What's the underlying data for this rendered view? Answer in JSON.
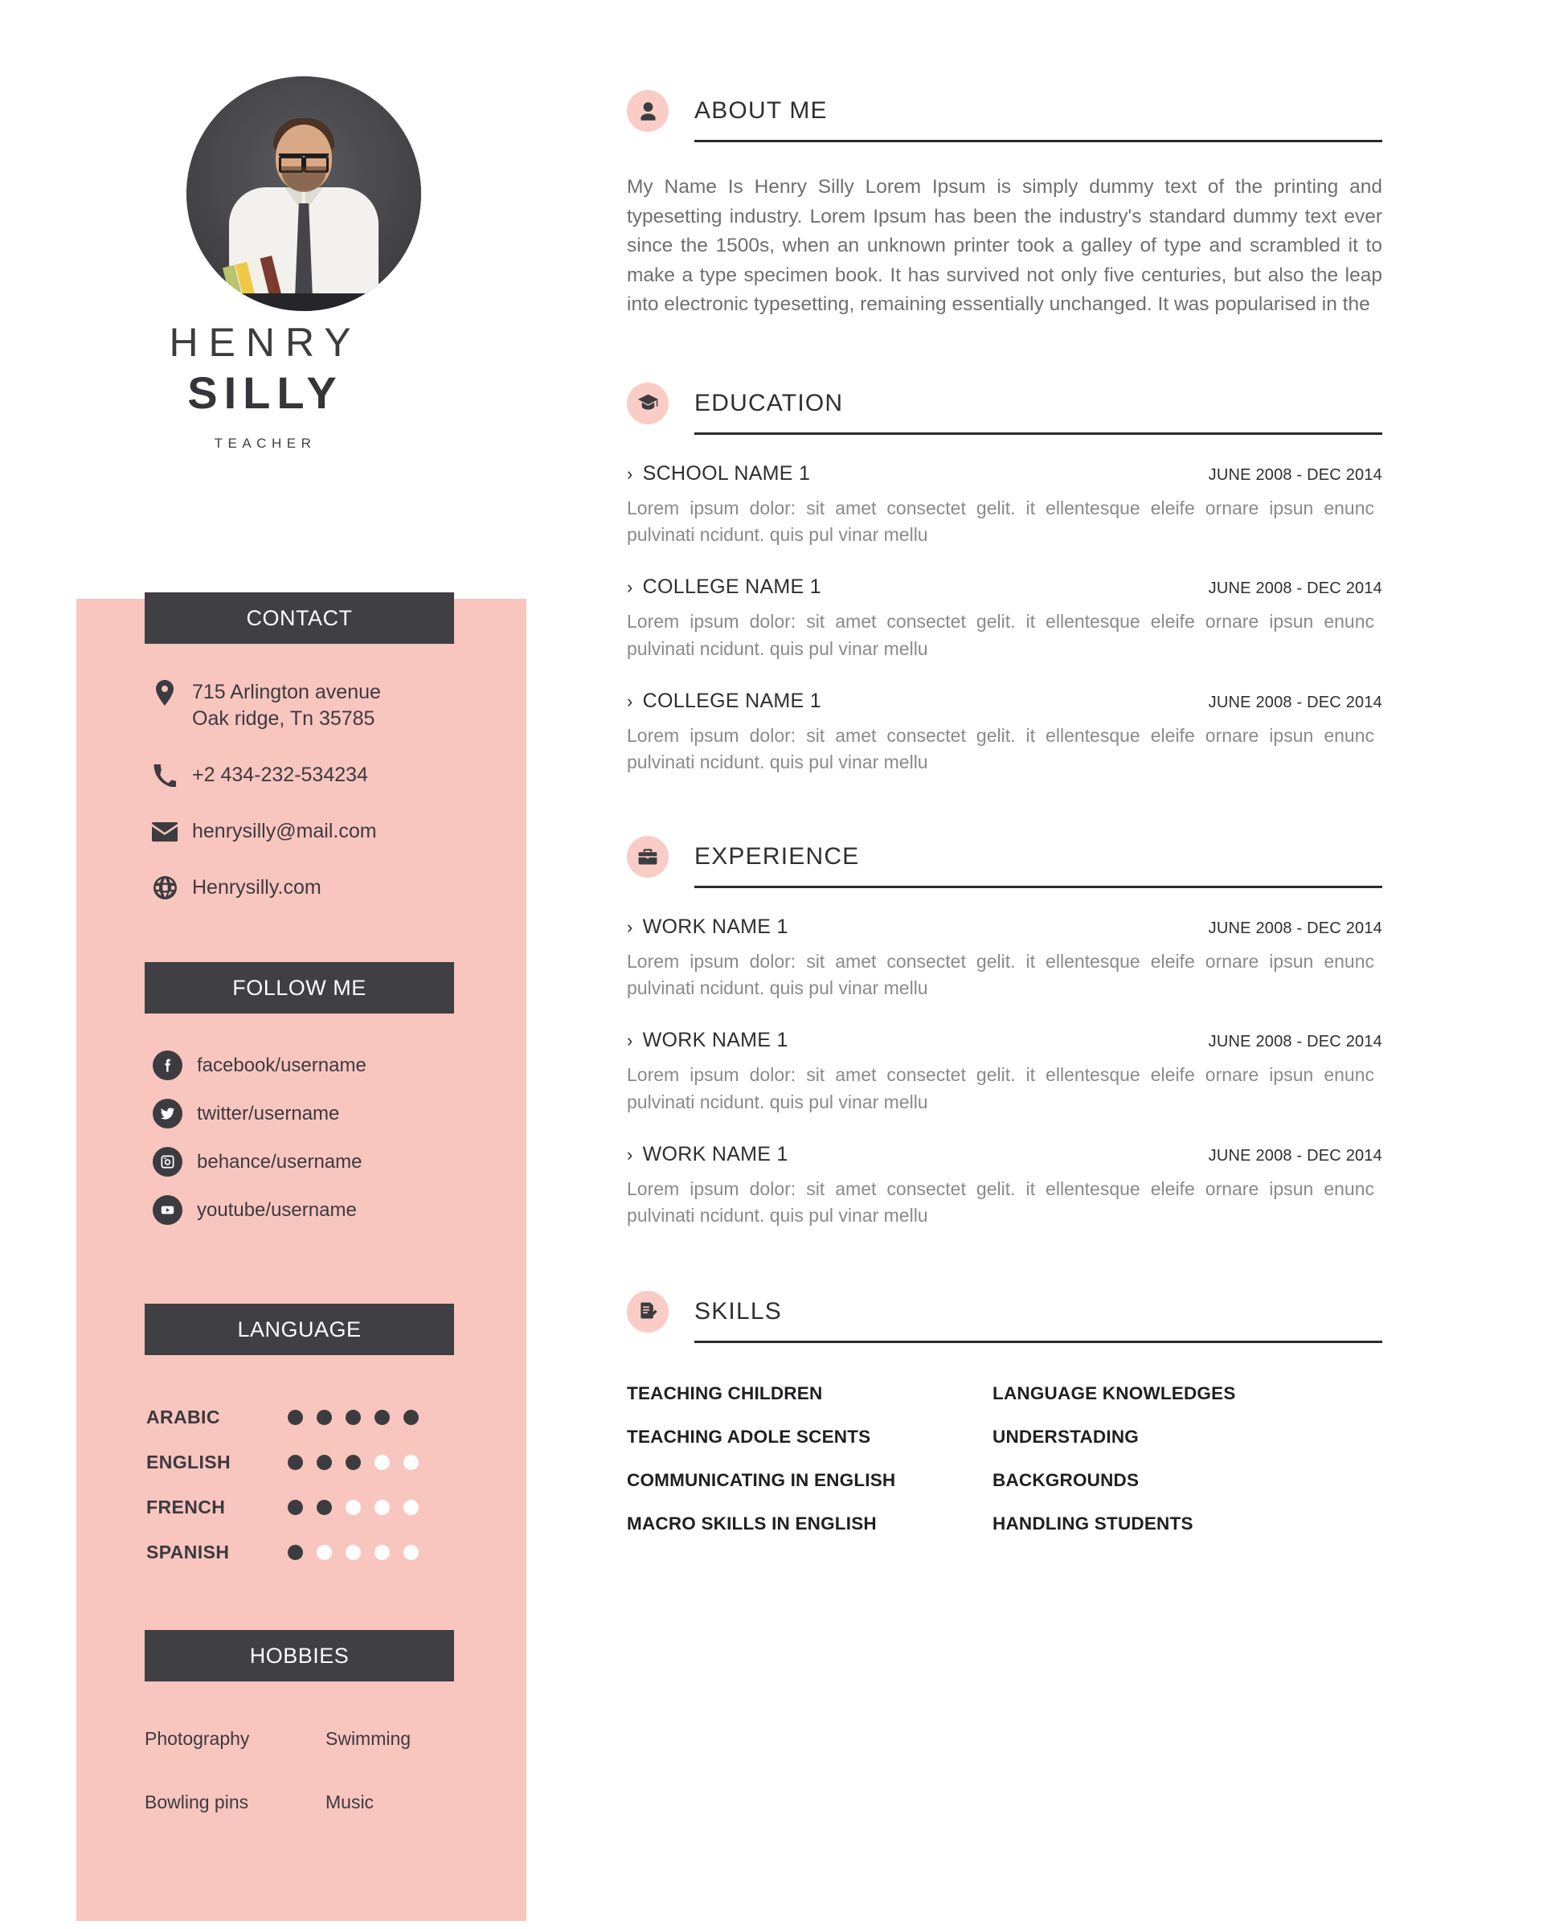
{
  "profile": {
    "first_name": "HENRY",
    "last_name": "SILLY",
    "role": "TEACHER",
    "photo_alt": "portrait-photo"
  },
  "sidebar": {
    "contact": {
      "title": "CONTACT",
      "items": [
        {
          "icon": "location-icon",
          "text": "715 Arlington avenue\nOak ridge, Tn 35785"
        },
        {
          "icon": "phone-icon",
          "text": "+2 434-232-534234"
        },
        {
          "icon": "email-icon",
          "text": "henrysilly@mail.com"
        },
        {
          "icon": "globe-icon",
          "text": "Henrysilly.com"
        }
      ]
    },
    "follow": {
      "title": "FOLLOW ME",
      "items": [
        {
          "icon": "facebook-icon",
          "text": "facebook/username"
        },
        {
          "icon": "twitter-icon",
          "text": "twitter/username"
        },
        {
          "icon": "instagram-icon",
          "text": "behance/username"
        },
        {
          "icon": "youtube-icon",
          "text": "youtube/username"
        }
      ]
    },
    "language": {
      "title": "LANGUAGE",
      "max_level": 5,
      "items": [
        {
          "name": "ARABIC",
          "level": 5
        },
        {
          "name": "ENGLISH",
          "level": 3
        },
        {
          "name": "FRENCH",
          "level": 2
        },
        {
          "name": "SPANISH",
          "level": 1
        }
      ]
    },
    "hobbies": {
      "title": "HOBBIES",
      "items": [
        "Photography",
        "Swimming",
        "Bowling pins",
        "Music"
      ]
    }
  },
  "main": {
    "about": {
      "icon": "person-icon",
      "title": "ABOUT ME",
      "text": "My Name Is Henry Silly Lorem Ipsum is simply dummy text of the printing and typesetting industry. Lorem Ipsum has been the industry's standard dummy text ever since the 1500s, when an unknown printer took a galley of type and scrambled it to make a type specimen book. It has survived not only five centuries, but also the leap into electronic typesetting, remaining essentially unchanged. It was popularised in the"
    },
    "education": {
      "icon": "graduation-cap-icon",
      "title": "EDUCATION",
      "entries": [
        {
          "name": "SCHOOL NAME 1",
          "date": "JUNE 2008 - DEC 2014",
          "desc": "Lorem ipsum dolor: sit amet consectet gelit. it ellentesque eleife ornare ipsun enunc pulvinati ncidunt. quis pul vinar mellu"
        },
        {
          "name": "COLLEGE NAME 1",
          "date": "JUNE 2008 - DEC 2014",
          "desc": "Lorem ipsum dolor: sit amet consectet gelit. it ellentesque eleife ornare ipsun enunc pulvinati ncidunt. quis pul vinar mellu"
        },
        {
          "name": "COLLEGE NAME 1",
          "date": "JUNE 2008 - DEC 2014",
          "desc": "Lorem ipsum dolor: sit amet consectet gelit. it ellentesque eleife ornare ipsun enunc pulvinati ncidunt. quis pul vinar mellu"
        }
      ]
    },
    "experience": {
      "icon": "briefcase-icon",
      "title": "EXPERIENCE",
      "entries": [
        {
          "name": "WORK NAME 1",
          "date": "JUNE 2008 - DEC 2014",
          "desc": "Lorem ipsum dolor: sit amet consectet gelit. it ellentesque eleife ornare ipsun enunc pulvinati ncidunt. quis pul vinar mellu"
        },
        {
          "name": "WORK NAME 1",
          "date": "JUNE 2008 - DEC 2014",
          "desc": "Lorem ipsum dolor: sit amet consectet gelit. it ellentesque eleife ornare ipsun enunc pulvinati ncidunt. quis pul vinar mellu"
        },
        {
          "name": "WORK NAME 1",
          "date": "JUNE 2008 - DEC 2014",
          "desc": "Lorem ipsum dolor: sit amet consectet gelit. it ellentesque eleife ornare ipsun enunc pulvinati ncidunt. quis pul vinar mellu"
        }
      ]
    },
    "skills": {
      "icon": "document-pencil-icon",
      "title": "SKILLS",
      "items": [
        "TEACHING CHILDREN",
        "LANGUAGE KNOWLEDGES",
        "TEACHING ADOLE SCENTS",
        "UNDERSTADING",
        "COMMUNICATING IN ENGLISH",
        "BACKGROUNDS",
        "MACRO SKILLS IN ENGLISH",
        "HANDLING STUDENTS"
      ]
    }
  },
  "colors": {
    "pink_panel": "#f9c5bf",
    "badge_pink": "#f9ccc6",
    "dark_bar": "#3f3f44",
    "body_text": "#6f6f72",
    "heading": "#2f2f33"
  },
  "entry_chevron": "›"
}
